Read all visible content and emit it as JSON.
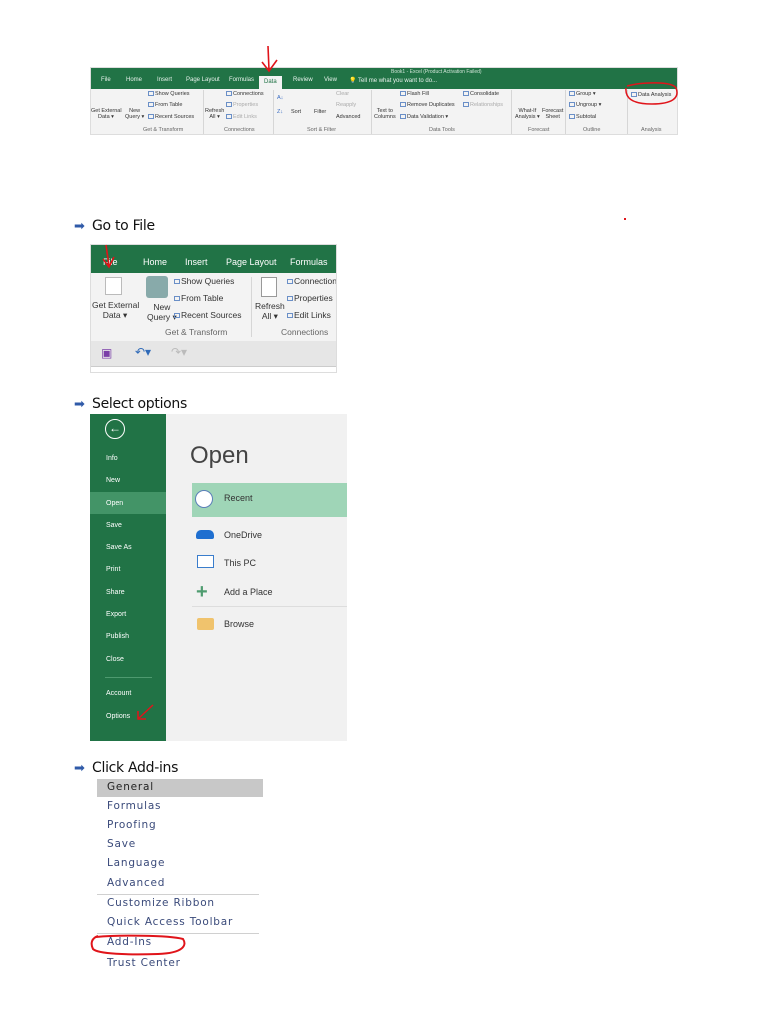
{
  "steps": {
    "go_to_file": "Go to File",
    "select_options": "Select options",
    "click_addins": "Click Add-ins"
  },
  "ribbon1": {
    "title": "Book1 - Excel (Product Activation Failed)",
    "tabs": [
      "File",
      "Home",
      "Insert",
      "Page Layout",
      "Formulas",
      "Data",
      "Review",
      "View"
    ],
    "active_tab": "Data",
    "tell_me": "Tell me what you want to do...",
    "get_external": [
      "Get External",
      "Data"
    ],
    "new_query": [
      "New",
      "Query"
    ],
    "show_queries": "Show Queries",
    "from_table": "From Table",
    "recent_sources": "Recent Sources",
    "refresh": [
      "Refresh",
      "All"
    ],
    "connections": "Connections",
    "properties": "Properties",
    "edit_links": "Edit Links",
    "sort": "Sort",
    "filter": "Filter",
    "clear": "Clear",
    "reapply": "Reapply",
    "advanced": "Advanced",
    "text_to_columns": [
      "Text to",
      "Columns"
    ],
    "flash_fill": "Flash Fill",
    "remove_duplicates": "Remove Duplicates",
    "data_validation": "Data Validation",
    "consolidate": "Consolidate",
    "relationships": "Relationships",
    "what_if": [
      "What-If",
      "Analysis"
    ],
    "forecast_sheet": [
      "Forecast",
      "Sheet"
    ],
    "group": "Group",
    "ungroup": "Ungroup",
    "subtotal": "Subtotal",
    "data_analysis": "Data Analysis",
    "groups": [
      "Get & Transform",
      "Connections",
      "Sort & Filter",
      "Data Tools",
      "Forecast",
      "Outline",
      "Analysis"
    ]
  },
  "ribbon2": {
    "tabs": [
      "File",
      "Home",
      "Insert",
      "Page Layout",
      "Formulas"
    ],
    "get_external": [
      "Get External",
      "Data"
    ],
    "new_query": [
      "New",
      "Query"
    ],
    "show_queries": "Show Queries",
    "from_table": "From Table",
    "recent_sources": "Recent Sources",
    "refresh": [
      "Refresh",
      "All"
    ],
    "connections": "Connections",
    "properties": "Properties",
    "edit_links": "Edit Links",
    "groups": [
      "Get & Transform",
      "Connections"
    ]
  },
  "backstage": {
    "menu": [
      "Info",
      "New",
      "Open",
      "Save",
      "Save As",
      "Print",
      "Share",
      "Export",
      "Publish",
      "Close"
    ],
    "menu_bottom": [
      "Account",
      "Options"
    ],
    "active": "Open",
    "title": "Open",
    "locations": [
      "Recent",
      "OneDrive",
      "This PC",
      "Add a Place",
      "Browse"
    ]
  },
  "options_list": {
    "items": [
      "General",
      "Formulas",
      "Proofing",
      "Save",
      "Language",
      "Advanced"
    ],
    "items2": [
      "Customize Ribbon",
      "Quick Access Toolbar"
    ],
    "items3": [
      "Add-Ins",
      "Trust Center"
    ],
    "selected": "General"
  },
  "colors": {
    "excel_green": "#217346",
    "annotation_red": "#e0141a",
    "arrow_blue": "#2f5aa8",
    "recent_highlight": "#9fd5b7"
  }
}
